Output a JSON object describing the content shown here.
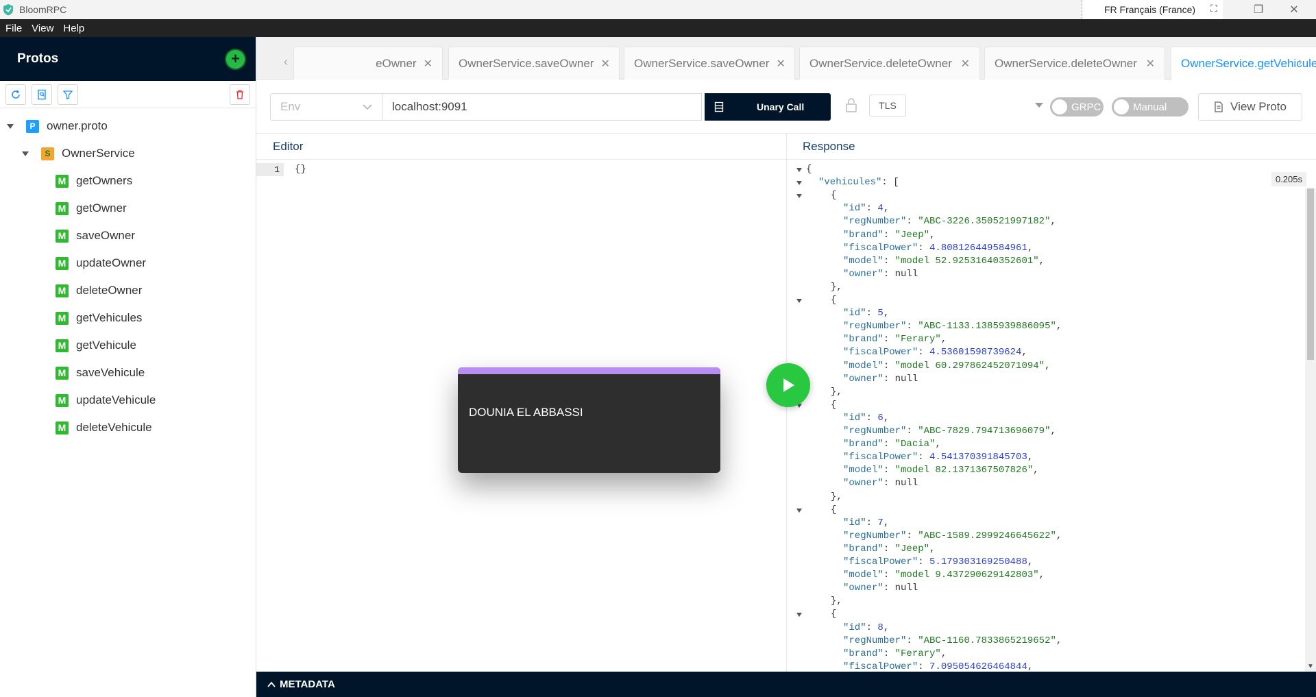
{
  "window": {
    "title": "BloomRPC",
    "language": "FR Français (France)"
  },
  "menu": [
    "File",
    "View",
    "Help"
  ],
  "sidebar": {
    "title": "Protos",
    "add_icon": "plus-icon",
    "tree": {
      "file": {
        "badge": "P",
        "label": "owner.proto"
      },
      "service": {
        "badge": "S",
        "label": "OwnerService"
      },
      "methods": [
        {
          "badge": "M",
          "label": "getOwners"
        },
        {
          "badge": "M",
          "label": "getOwner"
        },
        {
          "badge": "M",
          "label": "saveOwner"
        },
        {
          "badge": "M",
          "label": "updateOwner"
        },
        {
          "badge": "M",
          "label": "deleteOwner"
        },
        {
          "badge": "M",
          "label": "getVehicules"
        },
        {
          "badge": "M",
          "label": "getVehicule"
        },
        {
          "badge": "M",
          "label": "saveVehicule"
        },
        {
          "badge": "M",
          "label": "updateVehicule"
        },
        {
          "badge": "M",
          "label": "deleteVehicule"
        }
      ]
    }
  },
  "tabs": [
    {
      "label": "eOwner",
      "active": false
    },
    {
      "label": "OwnerService.saveOwner",
      "active": false
    },
    {
      "label": "OwnerService.saveOwner",
      "active": false
    },
    {
      "label": "OwnerService.deleteOwner",
      "active": false
    },
    {
      "label": "OwnerService.deleteOwner",
      "active": false
    },
    {
      "label": "OwnerService.getVehicules",
      "active": true
    }
  ],
  "toolbar": {
    "env_placeholder": "Env",
    "url": "localhost:9091",
    "call_label": "Unary Call",
    "tls_label": "TLS",
    "grpc_label": "GRPC",
    "manual_label": "Manual",
    "view_proto_label": "View Proto"
  },
  "editor": {
    "title": "Editor",
    "line_number": "1",
    "content": "{}"
  },
  "response": {
    "title": "Response",
    "timing": "0.205s",
    "vehicules": [
      {
        "id": "4",
        "regNumber": "ABC-3226.350521997182",
        "brand": "Jeep",
        "fiscalPower": "4.808126449584961",
        "model": "model 52.92531640352601",
        "owner": "null"
      },
      {
        "id": "5",
        "regNumber": "ABC-1133.1385939886095",
        "brand": "Ferary",
        "fiscalPower": "4.53601598739624",
        "model": "model 60.297862452071094",
        "owner": "null"
      },
      {
        "id": "6",
        "regNumber": "ABC-7829.794713696079",
        "brand": "Dacia",
        "fiscalPower": "4.541370391845703",
        "model": "model 82.1371367507826",
        "owner": "null"
      },
      {
        "id": "7",
        "regNumber": "ABC-1589.2999246645622",
        "brand": "Jeep",
        "fiscalPower": "5.179303169250488",
        "model": "model 9.437290629142803",
        "owner": "null"
      },
      {
        "id": "8",
        "regNumber": "ABC-1160.7833865219652",
        "brand": "Ferary",
        "fiscalPower": "7.095054626464844",
        "model": "",
        "owner": ""
      }
    ]
  },
  "overlay": {
    "name": "DOUNIA EL ABBASSI"
  },
  "metadata": {
    "label": "METADATA"
  }
}
